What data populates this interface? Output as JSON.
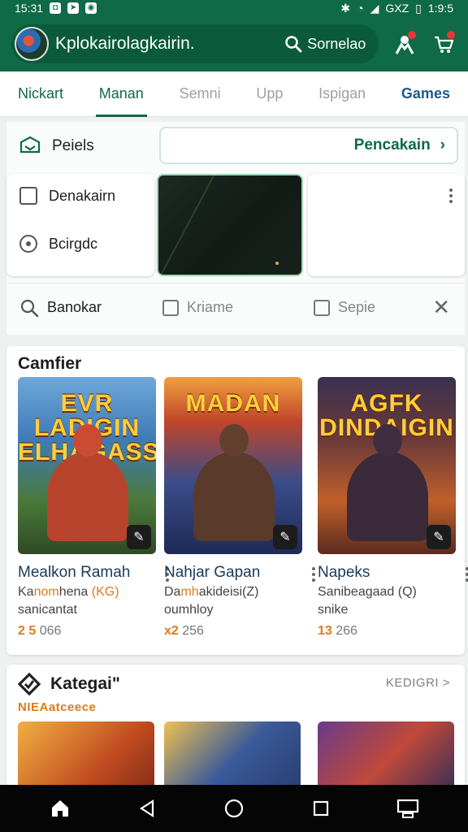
{
  "status": {
    "time": "15:31",
    "right_text": "GXZ",
    "clock": "1:9:5"
  },
  "header": {
    "app_title": "Kplokairolagkairin.",
    "search_label": "Sornelao"
  },
  "tabs": [
    {
      "label": "Nickart"
    },
    {
      "label": "Manan"
    },
    {
      "label": "Semni"
    },
    {
      "label": "Upp"
    },
    {
      "label": "Ispigan"
    },
    {
      "label": "Games"
    }
  ],
  "panel": {
    "pels_label": "Peiels",
    "pencakain_label": "Pencakain",
    "option1": "Denakairn",
    "option2": "Bcirgdc"
  },
  "filters": {
    "search_label": "Banokar",
    "check1": "Kriame",
    "check2": "Sepie"
  },
  "games": {
    "title": "Camfier",
    "items": [
      {
        "logo": "EVR LADIGIN ELHAGASS",
        "name": "Mealkon Ramah",
        "sub1_a": "Ka",
        "sub1_b": "nom",
        "sub1_c": "hena",
        "sub1_d": "(KG)",
        "sub2": "sanicantat",
        "rating_a": "2 5",
        "rating_b": "066"
      },
      {
        "logo": "MADAN",
        "name": "Nahjar Gapan",
        "sub1_a": "Da",
        "sub1_b": "mh",
        "sub1_c": "akideisi",
        "sub1_d": "(Z)",
        "sub2": "oumhloy",
        "rating_a": "x2",
        "rating_b": "256"
      },
      {
        "logo": "AGFK DINDAIGIN",
        "name": "Napeks",
        "sub1_a": "Sanibeagaad",
        "sub1_b": "",
        "sub1_c": "",
        "sub1_d": "(Q)",
        "sub2": "snike",
        "rating_a": "13",
        "rating_b": "266"
      }
    ]
  },
  "kategori": {
    "title": "Kategai\"",
    "link": "KEDIGRI >",
    "subtitle": "NIEAatceece"
  },
  "colors": {
    "brand": "#0f6a48",
    "accent": "#e07a1a",
    "link_blue": "#1f5a8a"
  }
}
